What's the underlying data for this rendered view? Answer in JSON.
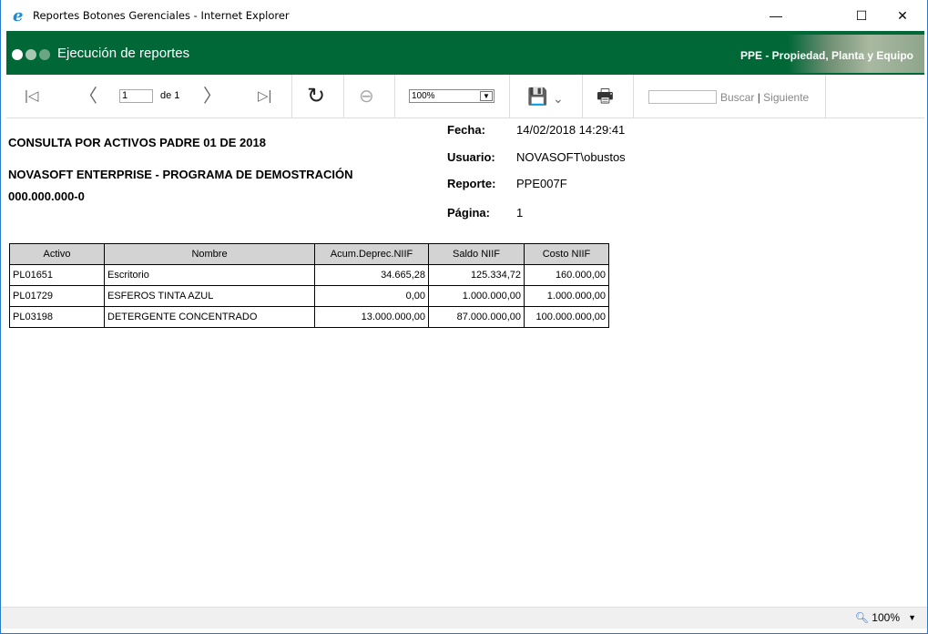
{
  "window": {
    "title": "Reportes Botones Gerenciales - Internet Explorer",
    "minimize": "—",
    "maximize": "☐",
    "close": "✕"
  },
  "header": {
    "title": "Ejecución de reportes",
    "module": "PPE - Propiedad, Planta y Equipo",
    "accent": "#006837"
  },
  "toolbar": {
    "first": "|◁",
    "prev": "〈",
    "page": "1",
    "of": "de 1",
    "next": "〉",
    "last": "▷|",
    "refresh": "↻",
    "back": "⊖",
    "zoom": "100%",
    "save": "💾",
    "save_arrow": "⌄",
    "print": "🖶",
    "search_value": "",
    "find": "Buscar",
    "separator": "|",
    "next_find": "Siguiente"
  },
  "report": {
    "title": "CONSULTA POR ACTIVOS PADRE 01 DE  2018",
    "company": "NOVASOFT ENTERPRISE - PROGRAMA DE DEMOSTRACIÓN",
    "nit": "000.000.000-0",
    "meta": [
      {
        "label": "Fecha:",
        "value": "14/02/2018 14:29:41"
      },
      {
        "label": "Usuario:",
        "value": "NOVASOFT\\obustos"
      },
      {
        "label": "Reporte:",
        "value": "PPE007F"
      },
      {
        "label": "Página:",
        "value": "1"
      }
    ],
    "columns": [
      "Activo",
      "Nombre",
      "Acum.Deprec.NIIF",
      "Saldo NIIF",
      "Costo NIIF"
    ],
    "rows": [
      [
        "PL01651",
        "Escritorio",
        "34.665,28",
        "125.334,72",
        "160.000,00"
      ],
      [
        "PL01729",
        "ESFEROS TINTA AZUL",
        "0,00",
        "1.000.000,00",
        "1.000.000,00"
      ],
      [
        "PL03198",
        "DETERGENTE CONCENTRADO",
        "13.000.000,00",
        "87.000.000,00",
        "100.000.000,00"
      ]
    ]
  },
  "status": {
    "zoom": "100%",
    "zoom_arrow": "▼"
  }
}
